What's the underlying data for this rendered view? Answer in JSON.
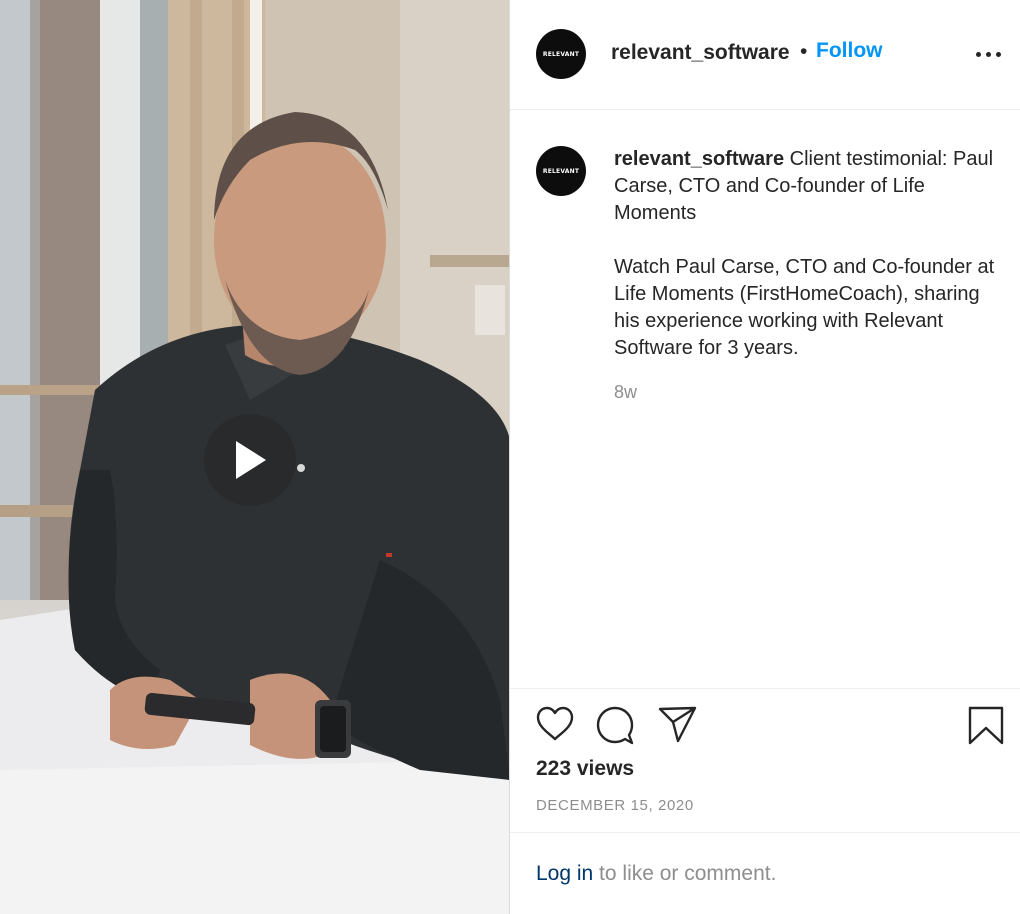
{
  "post": {
    "username": "relevant_software",
    "avatar_text": "RELEVANT",
    "follow_label": "Follow",
    "separator": "•",
    "more_icon": "more-options-icon"
  },
  "media": {
    "type": "video",
    "play_icon": "play-icon"
  },
  "caption": {
    "username": "relevant_software",
    "first_line": "Client testimonial: Paul Carse, CTO and Co-founder of Life Moments",
    "body": "Watch Paul Carse, CTO and Co-founder at Life Moments (FirstHomeCoach), sharing his experience working with Relevant Software for 3 years.",
    "time_ago": "8w"
  },
  "actions": {
    "like_icon": "heart-icon",
    "comment_icon": "comment-icon",
    "share_icon": "share-icon",
    "save_icon": "bookmark-icon"
  },
  "stats": {
    "views": "223 views",
    "date": "DECEMBER 15, 2020"
  },
  "login_prompt": {
    "link": "Log in",
    "rest": " to like or comment."
  },
  "colors": {
    "follow": "#0095f6",
    "link": "#00376b",
    "muted": "#8e8e8e",
    "text": "#262626"
  }
}
